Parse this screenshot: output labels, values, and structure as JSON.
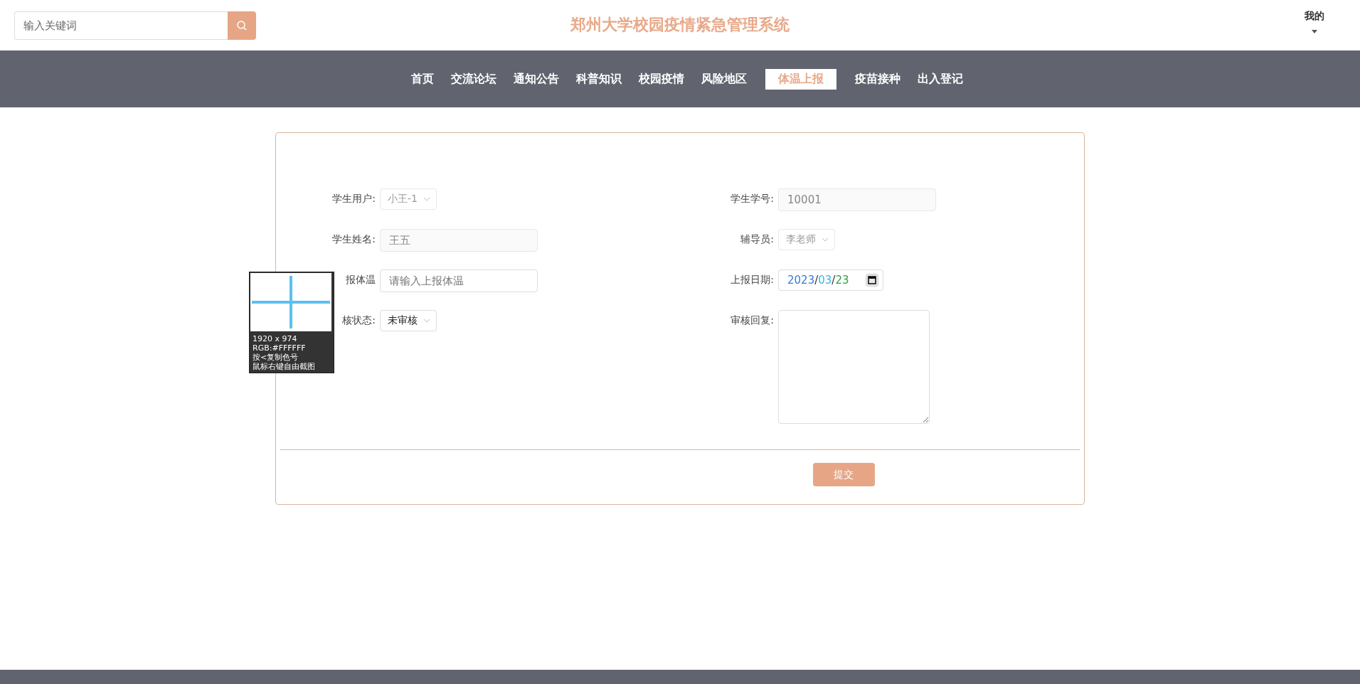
{
  "header": {
    "search": {
      "placeholder": "输入关键词"
    },
    "title": "郑州大学校园疫情紧急管理系统",
    "user_menu": "我的"
  },
  "nav": [
    {
      "label": "首页",
      "selected": false
    },
    {
      "label": "交流论坛",
      "selected": false
    },
    {
      "label": "通知公告",
      "selected": false
    },
    {
      "label": "科普知识",
      "selected": false
    },
    {
      "label": "校园疫情",
      "selected": false
    },
    {
      "label": "风险地区",
      "selected": false
    },
    {
      "label": "体温上报",
      "selected": true
    },
    {
      "label": "疫苗接种",
      "selected": false
    },
    {
      "label": "出入登记",
      "selected": false
    }
  ],
  "form": {
    "fields": [
      {
        "label": "学生用户:",
        "kind": "select",
        "value": "小王-1",
        "disabled": true
      },
      {
        "label": "学生学号:",
        "kind": "input",
        "value": "10001",
        "disabled": true
      },
      {
        "label": "学生姓名:",
        "kind": "input",
        "value": "王五",
        "disabled": true
      },
      {
        "label": "辅导员:",
        "kind": "select",
        "value": "李老师",
        "disabled": true
      },
      {
        "label": "报体温",
        "kind": "input",
        "placeholder": "请输入上报体温"
      },
      {
        "label": "上报日期:",
        "kind": "date",
        "parts": [
          {
            "text": "2023",
            "color": "#3a7bd5"
          },
          {
            "text": "/",
            "color": "#333333"
          },
          {
            "text": "03",
            "color": "#35b6e6"
          },
          {
            "text": "/",
            "color": "#333333"
          },
          {
            "text": "23",
            "color": "#2ea043"
          }
        ]
      },
      {
        "label": "核状态:",
        "kind": "select",
        "value": "未审核",
        "disabled": false
      },
      {
        "label": "审核回复:",
        "kind": "textarea"
      }
    ],
    "submit": "提交"
  },
  "color_picker": {
    "lines": [
      "1920 x 974",
      "RGB:#FFFFFF",
      "按<复制色号",
      "鼠标右键自由截图"
    ]
  }
}
